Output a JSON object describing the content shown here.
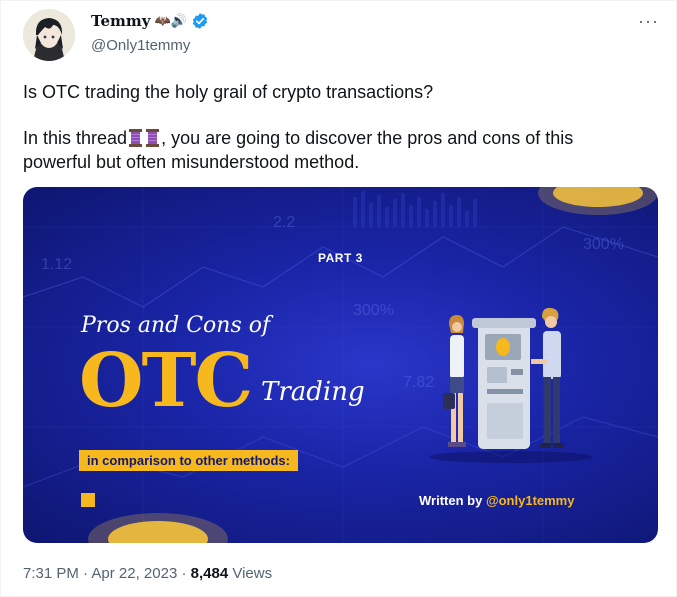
{
  "author": {
    "display_name": "Temmy",
    "name_emojis": "🦇🔊",
    "handle": "@Only1temmy",
    "verified_icon": "verified-badge-icon"
  },
  "more_icon": "···",
  "tweet": {
    "line1": "Is OTC trading the holy grail of crypto transactions?",
    "line2_before": "In this thread",
    "line2_after": ", you are going to discover the pros and cons of this",
    "line3": "powerful but often misunderstood method.",
    "emoji_icon": "thread-spool-icon"
  },
  "media": {
    "part": "PART 3",
    "title_top": "Pros and Cons of",
    "title_big": "OTC",
    "title_small": "Trading",
    "subtitle": "in comparison to other methods:",
    "written_by": "Written by ",
    "written_handle": "@only1temmy",
    "bg_numbers": [
      "1.12",
      "300%",
      "300%",
      "2.2",
      "7.82"
    ],
    "colors": {
      "gold": "#f6b81c",
      "navy": "#1a25a8"
    }
  },
  "meta": {
    "time": "7:31 PM",
    "separator": " · ",
    "date": "Apr 22, 2023",
    "views_count": "8,484",
    "views_label": " Views"
  }
}
